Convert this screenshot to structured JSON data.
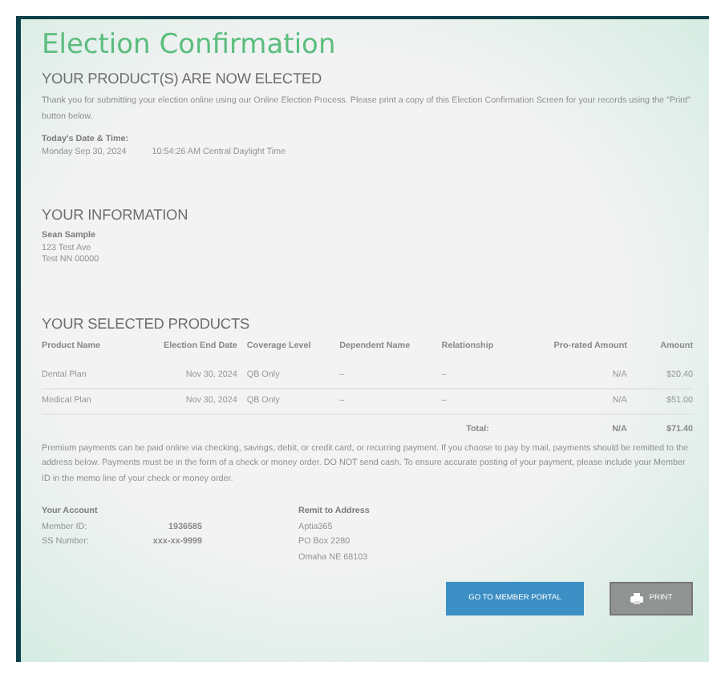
{
  "title": "Election Confirmation",
  "elected": {
    "heading": "YOUR PRODUCT(S) ARE NOW ELECTED",
    "message": "Thank you for submitting your election online using our Online Election Process. Please print a copy of this Election Confirmation Screen for your records using the \"Print\" button below.",
    "date_label": "Today's Date & Time:",
    "date": "Monday Sep 30, 2024",
    "time": "10:54:26 AM Central Daylight Time"
  },
  "information": {
    "heading": "YOUR INFORMATION",
    "name": "Sean Sample",
    "address_lines": [
      "123 Test Ave",
      "Test NN 00000"
    ]
  },
  "products": {
    "heading": "YOUR SELECTED PRODUCTS",
    "columns": [
      "Product Name",
      "Election End Date",
      "Coverage Level",
      "Dependent Name",
      "Relationship",
      "Pro-rated Amount",
      "Amount"
    ],
    "rows": [
      {
        "cells": [
          "Dental Plan",
          "Nov 30, 2024",
          "QB Only",
          "–",
          "–",
          "N/A",
          "$20.40"
        ]
      },
      {
        "cells": [
          "Medical Plan",
          "Nov 30, 2024",
          "QB Only",
          "–",
          "–",
          "N/A",
          "$51.00"
        ]
      }
    ],
    "total": {
      "label": "Total:",
      "prorated": "N/A",
      "amount": "$71.40"
    },
    "note": "Premium payments can be paid online via checking, savings, debit, or credit card, or recurring payment. If you choose to pay by mail, payments should be remitted to the address below. Payments must be in the form of a check or money order. DO NOT send cash. To ensure accurate posting of your payment, please include your Member ID in the memo line of your check or money order."
  },
  "account": {
    "heading": "Your Account",
    "fields": [
      {
        "label": "Member ID:",
        "value": "1936585"
      },
      {
        "label": "SS Number:",
        "value": "xxx-xx-9999"
      }
    ]
  },
  "remit": {
    "heading": "Remit to Address",
    "lines": [
      "Aptia365",
      "PO Box 2280",
      "Omaha NE 68103"
    ]
  },
  "buttons": [
    {
      "kind": "primary",
      "label": "GO TO MEMBER PORTAL"
    },
    {
      "kind": "print",
      "label": "PRINT"
    }
  ]
}
